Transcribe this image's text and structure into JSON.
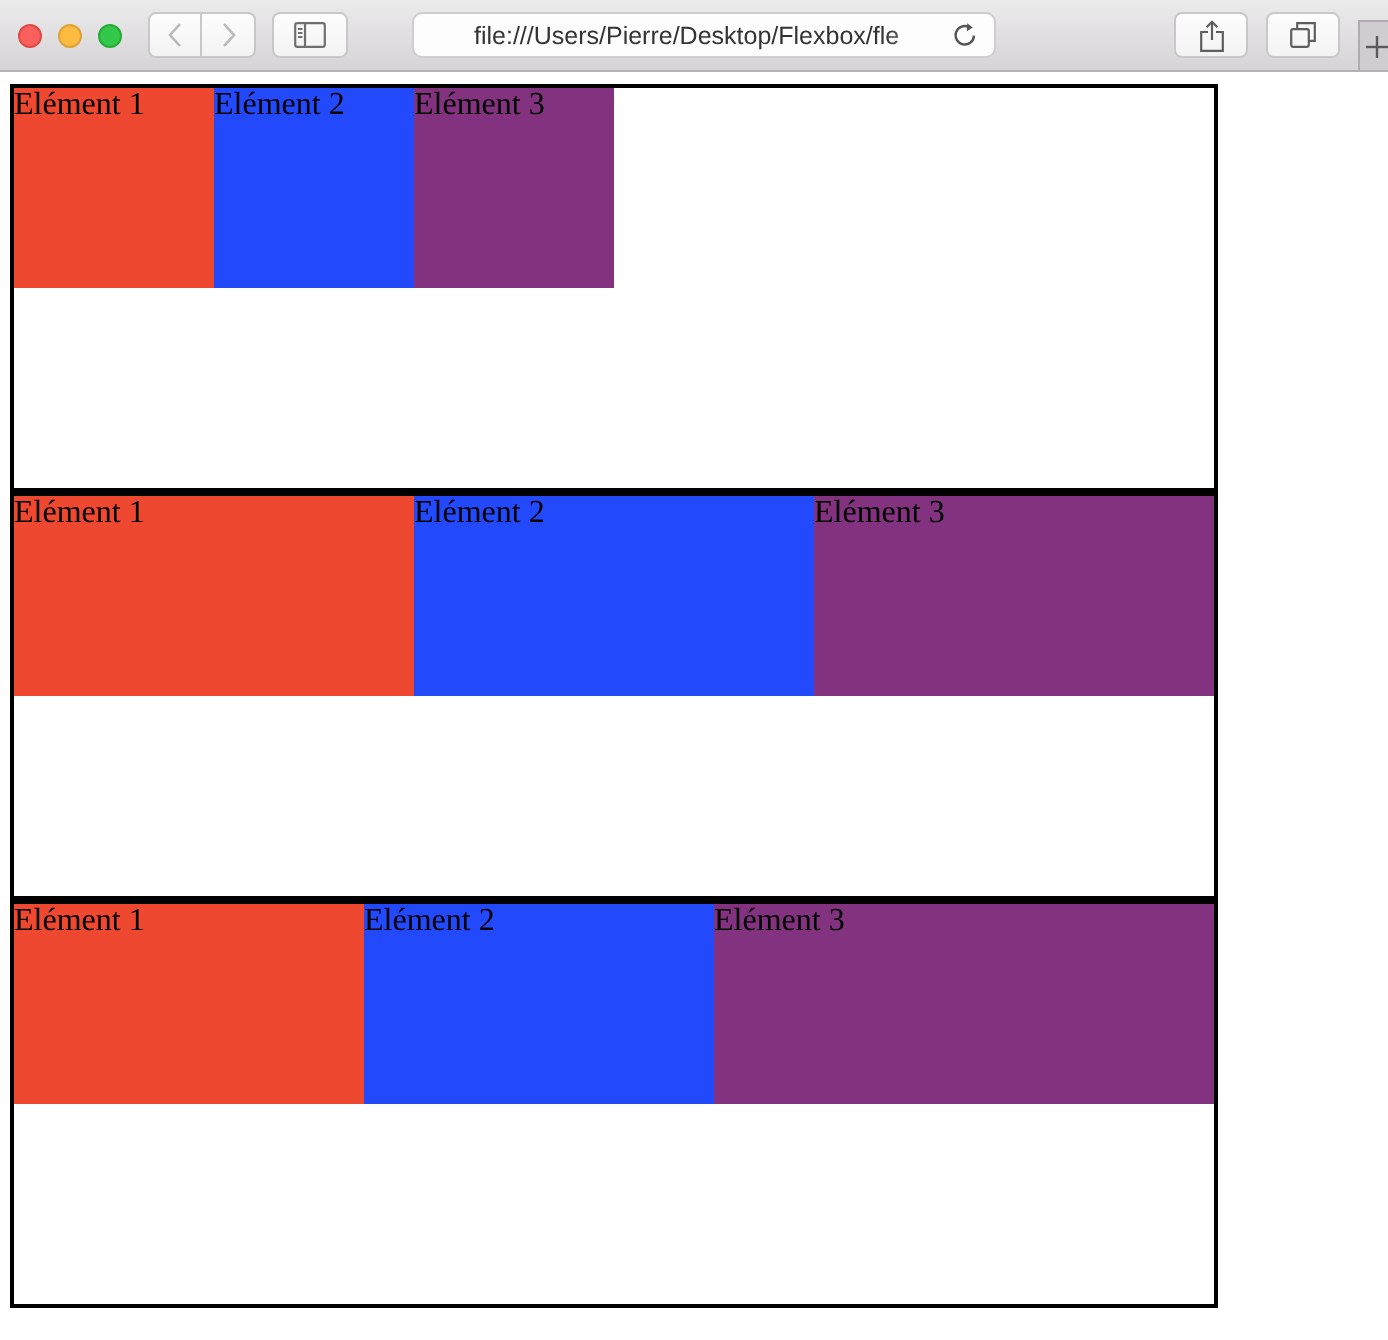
{
  "browser": {
    "navigation": {
      "back": {
        "disabled": true
      },
      "forward": {
        "disabled": true
      }
    },
    "address": "file:///Users/Pierre/Desktop/Flexbox/fle"
  },
  "containers": [
    {
      "kind": "fixed",
      "items": [
        {
          "label": "Elément 1",
          "color": "#ef4830"
        },
        {
          "label": "Elément 2",
          "color": "#2349fd"
        },
        {
          "label": "Elément 3",
          "color": "#82327e"
        }
      ]
    },
    {
      "kind": "equal",
      "items": [
        {
          "label": "Elément 1",
          "color": "#ef4830"
        },
        {
          "label": "Elément 2",
          "color": "#2349fd"
        },
        {
          "label": "Elément 3",
          "color": "#82327e"
        }
      ]
    },
    {
      "kind": "weighted",
      "items": [
        {
          "label": "Elément 1",
          "color": "#ef4830"
        },
        {
          "label": "Elément 2",
          "color": "#2349fd"
        },
        {
          "label": "Elément 3",
          "color": "#82327e"
        }
      ]
    }
  ]
}
